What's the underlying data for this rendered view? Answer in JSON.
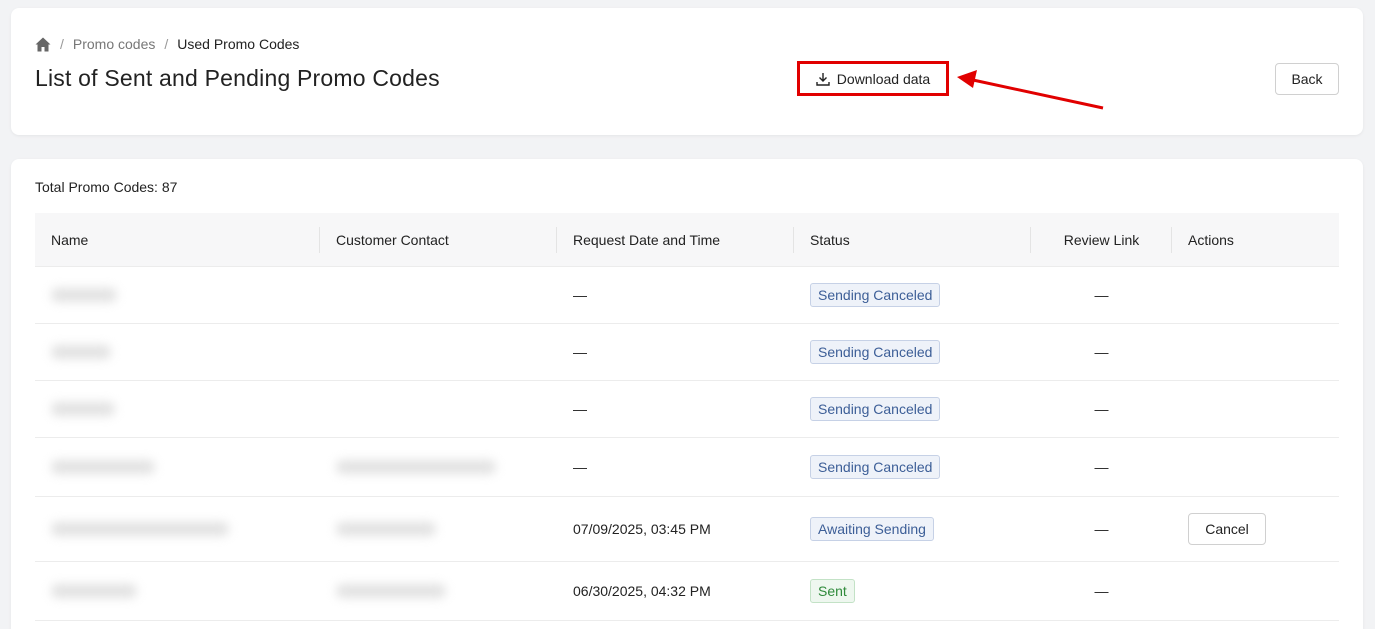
{
  "breadcrumb": {
    "home_icon": "home-icon",
    "items": [
      "Promo codes",
      "Used Promo Codes"
    ],
    "separator": "/"
  },
  "page": {
    "title": "List of Sent and Pending Promo Codes"
  },
  "toolbar": {
    "download_label": "Download data",
    "download_icon": "download-icon",
    "back_label": "Back",
    "highlight_color": "#e10000"
  },
  "summary": {
    "total_label": "Total Promo Codes: 87"
  },
  "table": {
    "headers": [
      "Name",
      "Customer Contact",
      "Request Date and Time",
      "Status",
      "Review Link",
      "Actions"
    ],
    "rows": [
      {
        "request": "—",
        "status": "Sending Canceled",
        "review": "—",
        "action": ""
      },
      {
        "request": "—",
        "status": "Sending Canceled",
        "review": "—",
        "action": ""
      },
      {
        "request": "—",
        "status": "Sending Canceled",
        "review": "—",
        "action": ""
      },
      {
        "request": "—",
        "status": "Sending Canceled",
        "review": "—",
        "action": ""
      },
      {
        "request": "07/09/2025, 03:45 PM",
        "status": "Awaiting Sending",
        "review": "—",
        "action": "Cancel"
      },
      {
        "request": "06/30/2025, 04:32 PM",
        "status": "Sent",
        "review": "—",
        "action": ""
      }
    ]
  },
  "colors": {
    "status_canceled": "#3c5e97",
    "status_sent": "#2f8a3b"
  }
}
